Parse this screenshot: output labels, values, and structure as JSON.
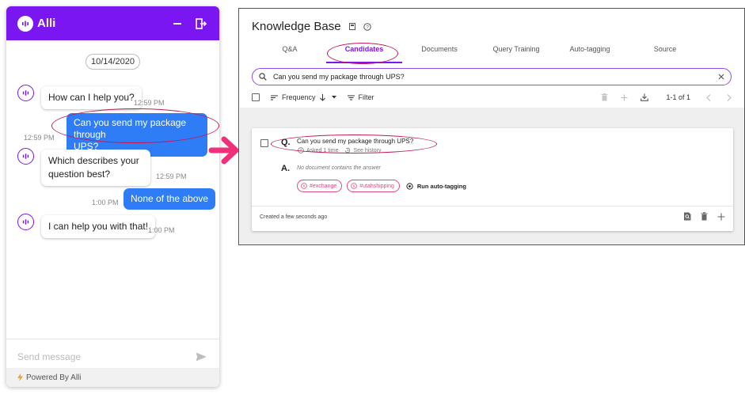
{
  "chat": {
    "brand": "Alli",
    "date": "10/14/2020",
    "messages": [
      {
        "from": "bot",
        "text": "How can I help you?",
        "time": "12:59 PM"
      },
      {
        "from": "user",
        "line1": "Can you send my package through",
        "line2": "UPS?",
        "time": "12:59 PM"
      },
      {
        "from": "bot",
        "line1": "Which describes your",
        "line2": "question best?",
        "time": "12:59 PM"
      },
      {
        "from": "user",
        "text": "None of the above",
        "time": "1:00 PM"
      },
      {
        "from": "bot",
        "text": "I can help you with that!",
        "time": "1:00 PM"
      }
    ],
    "input_placeholder": "Send message",
    "footer": "Powered By Alli",
    "accent": "#7a16f2",
    "user_bubble_color": "#2f7df6"
  },
  "kb": {
    "title": "Knowledge Base",
    "tabs": [
      "Q&A",
      "Candidates",
      "Documents",
      "Query Training",
      "Auto-tagging",
      "Source"
    ],
    "active_tab": "Candidates",
    "search_value": "Can you send my package through UPS?",
    "toolbar": {
      "sort_label": "Frequency",
      "filter_label": "Filter",
      "pager": "1-1 of 1"
    },
    "card": {
      "q_label": "Q.",
      "question": "Can you send my package through UPS?",
      "asked": "Asked 1 time",
      "history": "See history",
      "a_label": "A.",
      "answer": "No document contains the answer",
      "tags": [
        "#exchange",
        "#utahshipping"
      ],
      "auto_tag": "Run auto-tagging",
      "created": "Created",
      "created_when": "a few seconds ago"
    }
  },
  "highlight_color": "#c0195a",
  "arrow_color": "#f0307a"
}
